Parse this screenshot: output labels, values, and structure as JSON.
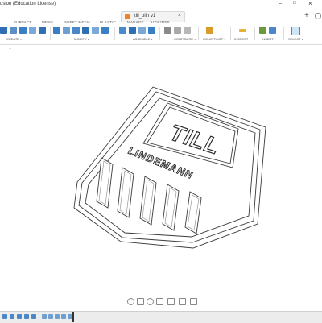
{
  "window": {
    "title": "usion (Education License)"
  },
  "document_tab": {
    "name": "till_plin v1"
  },
  "workspace_tabs": [
    "SURFACE",
    "MESH",
    "SHEET METAL",
    "PLASTIC",
    "MANAGE",
    "UTILITIES"
  ],
  "toolbar_groups": {
    "create": "CREATE ▾",
    "modify": "MODIFY ▾",
    "assemble": "ASSEMBLE ▾",
    "configure": "CONFIGURE ▾",
    "construct": "CONSTRUCT ▾",
    "inspect": "INSPECT ▾",
    "insert": "INSERT ▾",
    "select": "SELECT ▾"
  },
  "model": {
    "logo_text": "TILL",
    "name_text": "LINDEMANN"
  },
  "colors": {
    "accent": "#0696d7",
    "create_icon": "#2f6fb3",
    "modify_icon": "#3a7fc6",
    "assemble_icon": "#4a8ad0",
    "construct_icon": "#d99c2b",
    "insert_icon": "#6a9a3a",
    "model_line": "#3a3a3a"
  }
}
